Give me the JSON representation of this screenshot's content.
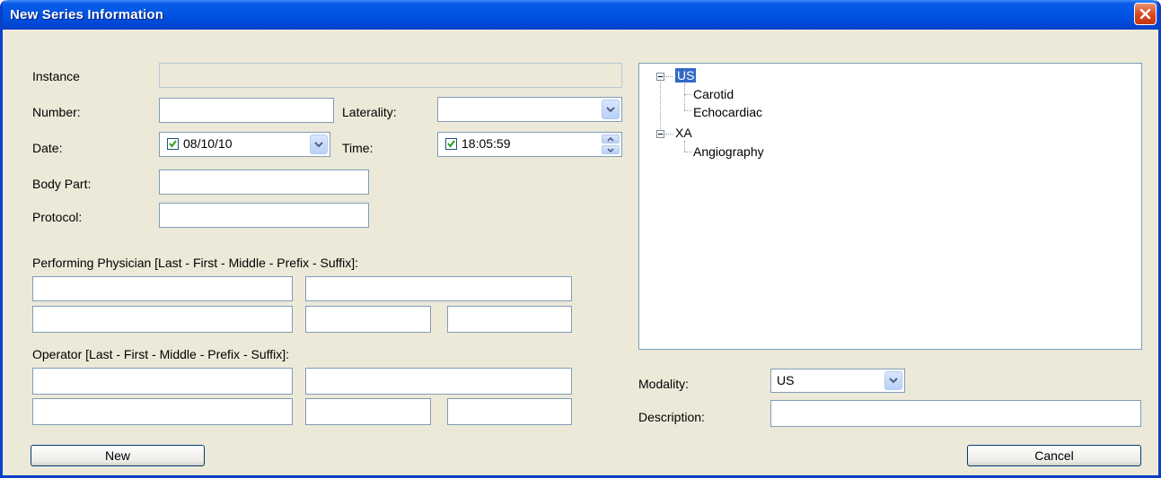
{
  "window": {
    "title": "New Series Information"
  },
  "form": {
    "instance": {
      "label": "Instance",
      "value": ""
    },
    "number": {
      "label": "Number:",
      "value": ""
    },
    "laterality": {
      "label": "Laterality:",
      "value": ""
    },
    "date": {
      "label": "Date:",
      "value": "08/10/10",
      "checked": true
    },
    "time": {
      "label": "Time:",
      "value": "18:05:59",
      "checked": true
    },
    "body_part": {
      "label": "Body Part:",
      "value": ""
    },
    "protocol": {
      "label": "Protocol:",
      "value": ""
    },
    "performing_physician": {
      "label": "Performing Physician [Last - First - Middle - Prefix - Suffix]:",
      "last": "",
      "first": "",
      "middle": "",
      "prefix": "",
      "suffix": ""
    },
    "operator": {
      "label": "Operator [Last - First - Middle - Prefix - Suffix]:",
      "last": "",
      "first": "",
      "middle": "",
      "prefix": "",
      "suffix": ""
    },
    "modality": {
      "label": "Modality:",
      "value": "US"
    },
    "description": {
      "label": "Description:",
      "value": ""
    }
  },
  "tree": {
    "nodes": [
      {
        "label": "US",
        "selected": true,
        "children": [
          "Carotid",
          "Echocardiac"
        ]
      },
      {
        "label": "XA",
        "selected": false,
        "children": [
          "Angiography"
        ]
      }
    ]
  },
  "buttons": {
    "new": "New",
    "cancel": "Cancel"
  },
  "icons": {
    "close": "close-icon",
    "dropdown": "chevron-down-icon",
    "checkbox": "checkmark-icon",
    "spin": "spin-arrows-icon"
  }
}
